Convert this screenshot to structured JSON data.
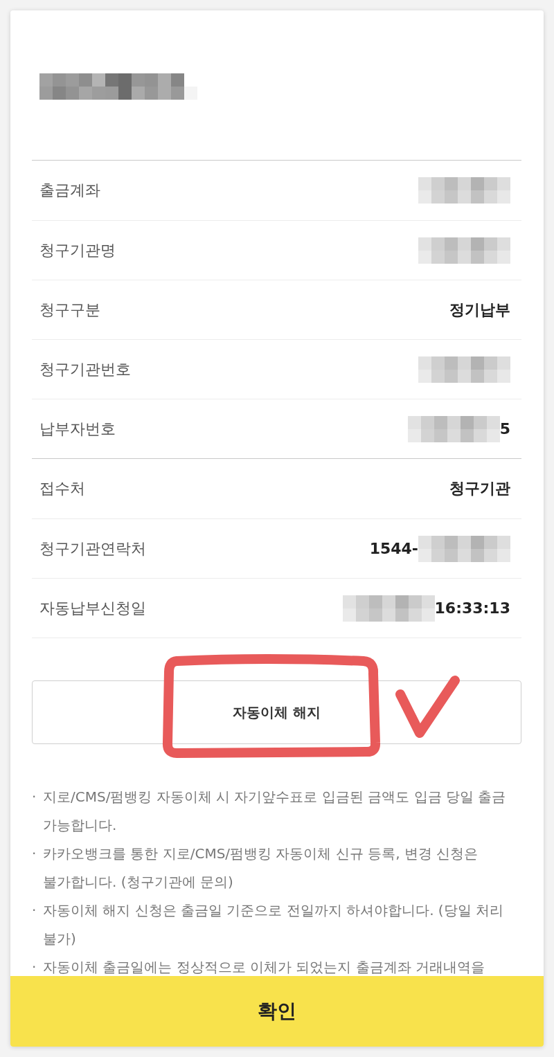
{
  "title": {
    "kind": "masked"
  },
  "sections": [
    {
      "rows": [
        {
          "label": "출금계좌",
          "value": [
            {
              "kind": "masked"
            }
          ]
        },
        {
          "label": "청구기관명",
          "value": [
            {
              "kind": "masked"
            }
          ]
        },
        {
          "label": "청구구분",
          "value": [
            {
              "kind": "text",
              "text": "정기납부"
            }
          ]
        },
        {
          "label": "청구기관번호",
          "value": [
            {
              "kind": "masked"
            }
          ]
        },
        {
          "label": "납부자번호",
          "value": [
            {
              "kind": "masked"
            },
            {
              "kind": "text",
              "text": "5"
            }
          ]
        }
      ]
    },
    {
      "rows": [
        {
          "label": "접수처",
          "value": [
            {
              "kind": "text",
              "text": "청구기관"
            }
          ]
        },
        {
          "label": "청구기관연락처",
          "value": [
            {
              "kind": "text",
              "text": "1544-"
            },
            {
              "kind": "masked"
            }
          ]
        },
        {
          "label": "자동납부신청일",
          "value": [
            {
              "kind": "masked"
            },
            {
              "kind": "text",
              "text": "16:33:13"
            }
          ]
        }
      ]
    }
  ],
  "cancel_button": {
    "label": "자동이체 해지",
    "hand_drawn_frame": true,
    "hand_drawn_check": true
  },
  "notes": {
    "marker": "·",
    "items": [
      "지로/CMS/펌뱅킹 자동이체 시 자기앞수표로 입금된 금액도 입금 당일 출금 가능합니다.",
      "카카오뱅크를 통한 지로/CMS/펌뱅킹 자동이체 신규 등록, 변경 신청은 불가합니다. (청구기관에 문의)",
      "자동이체 해지 신청은 출금일 기준으로 전일까지 하셔야합니다. (당일 처리 불가)",
      "자동이체 출금일에는 정상적으로 이체가 되었는지 출금계좌 거래내역을"
    ]
  },
  "confirm_button": {
    "label": "확인"
  }
}
